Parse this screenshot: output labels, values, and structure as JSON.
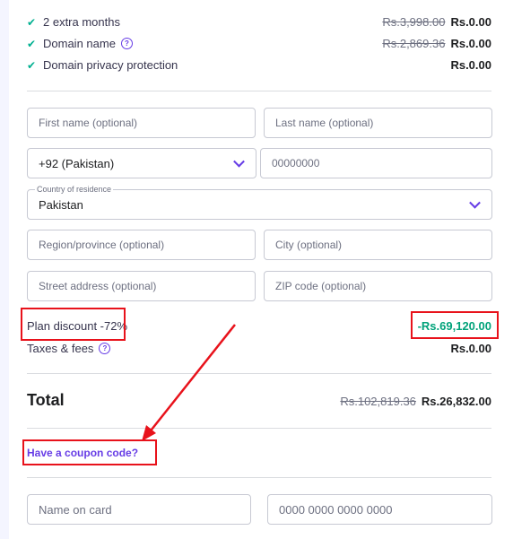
{
  "features": [
    {
      "label": "2 extra months",
      "old_price": "Rs.3,998.00",
      "price": "Rs.0.00",
      "help": false
    },
    {
      "label": "Domain name",
      "old_price": "Rs.2,869.36",
      "price": "Rs.0.00",
      "help": true
    },
    {
      "label": "Domain privacy protection",
      "old_price": "",
      "price": "Rs.0.00",
      "help": false
    }
  ],
  "form": {
    "first_name_placeholder": "First name (optional)",
    "last_name_placeholder": "Last name (optional)",
    "country_code": "+92 (Pakistan)",
    "phone_placeholder": "00000000",
    "country_label": "Country of residence",
    "country": "Pakistan",
    "region_placeholder": "Region/province (optional)",
    "city_placeholder": "City (optional)",
    "street_placeholder": "Street address (optional)",
    "zip_placeholder": "ZIP code (optional)",
    "name_on_card_placeholder": "Name on card",
    "card_number_placeholder": "0000 0000 0000 0000"
  },
  "summary": {
    "plan_discount_label": "Plan discount -72%",
    "plan_discount_value": "-Rs.69,120.00",
    "taxes_label": "Taxes & fees",
    "taxes_value": "Rs.0.00",
    "total_label": "Total",
    "total_old": "Rs.102,819.36",
    "total_new": "Rs.26,832.00",
    "coupon_link": "Have a coupon code?"
  },
  "icons": {
    "check": "check-icon",
    "help": "question-circle-icon",
    "chevron": "chevron-down-icon"
  },
  "colors": {
    "accent": "#673de6",
    "discount": "#00a27a",
    "annotation": "#e8121b"
  }
}
